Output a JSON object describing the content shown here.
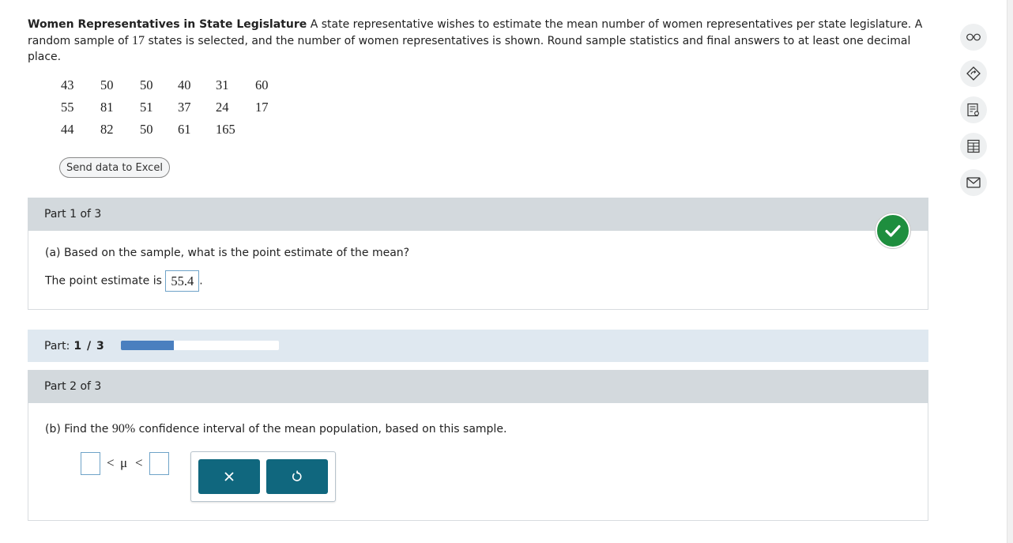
{
  "problem": {
    "title": "Women Representatives in State Legislature",
    "text_part1": "A state representative wishes to estimate the mean number of women representatives per state legislature. A random sample of",
    "sample_size": "17",
    "text_part2": "states is selected, and the number of women representatives is shown. Round sample statistics and final answers to at least one decimal place."
  },
  "data_values": [
    [
      "43",
      "50",
      "50",
      "40",
      "31",
      "60"
    ],
    [
      "55",
      "81",
      "51",
      "37",
      "24",
      "17"
    ],
    [
      "44",
      "82",
      "50",
      "61",
      "165"
    ]
  ],
  "excel_button_label": "Send data to Excel",
  "part1": {
    "header": "Part 1 of 3",
    "question": "(a) Based on the sample, what is the point estimate of the mean?",
    "answer_prefix": "The point estimate is",
    "answer_value": "55.4",
    "answer_suffix": ".",
    "status": "correct"
  },
  "progress": {
    "label": "Part:",
    "value": "1 / 3",
    "fraction": 0.3333
  },
  "part2": {
    "header": "Part 2 of 3",
    "question_prefix": "(b) Find the",
    "confidence": "90%",
    "question_suffix": "confidence interval of the mean population, based on this sample.",
    "interval_lt1": "<",
    "interval_mu": "μ",
    "interval_lt2": "<",
    "lower_value": "",
    "upper_value": ""
  },
  "tools": {
    "clear_symbol": "×",
    "undo_symbol": "↺"
  },
  "side_toolbar": [
    "glasses-icon",
    "calculator-icon",
    "textbook-icon",
    "data-table-icon",
    "message-icon"
  ],
  "colors": {
    "teal": "#10677e",
    "correct_green": "#1e8e3e",
    "progress_blue": "#4a7fbf"
  }
}
